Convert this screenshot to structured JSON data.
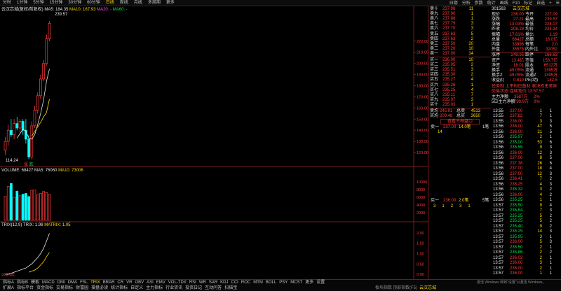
{
  "toolbar": {
    "items": [
      "分时",
      "1分钟",
      "5分钟",
      "15分钟",
      "30分钟",
      "60分钟",
      "日线",
      "周线",
      "月线",
      "多周期",
      "更多"
    ],
    "active": 6,
    "right_items": [
      "日期",
      "分析",
      "参数",
      "统计",
      "画线",
      "F10",
      "标记",
      "自选",
      "+",
      "☰"
    ]
  },
  "chart_header": {
    "stock": "云汉芯城(复权/前复权)",
    "ma5": "MA5: 184.35",
    "ma10": "MA10: 167.93",
    "ma20": "MA20: -",
    "ma60": "MA60: -",
    "high_label": "239.57",
    "low_label": "114.24",
    "marks": [
      "涨",
      "跌"
    ]
  },
  "price_axis": [
    "220.00",
    "210.00",
    "200.00",
    "190.00",
    "180.00",
    "170.00",
    "160.00",
    "150.00",
    "140.00",
    "130.00",
    "120.00"
  ],
  "volume_header": {
    "title": "VOLUME: 68427",
    "ma5": "MA5: 76060",
    "ma10": "MA10: 73006"
  },
  "volume_axis": [
    "10000",
    "8000",
    "6000",
    "4000",
    "2000"
  ],
  "trix_header": {
    "title": "TRIX(12,9)",
    "trix": "TRIX: 1.98",
    "matrix": "MATRIX: 1.05"
  },
  "trix_axis": [
    "2.00",
    "1.50",
    "1.00",
    "0.50",
    "0.00"
  ],
  "year_label": "2025年",
  "chart_data": {
    "type": "candlestick",
    "candles": [
      {
        "o": 122,
        "h": 134,
        "l": 118,
        "c": 130
      },
      {
        "o": 130,
        "h": 145,
        "l": 126,
        "c": 140
      },
      {
        "o": 140,
        "h": 150,
        "l": 134,
        "c": 136
      },
      {
        "o": 136,
        "h": 150,
        "l": 132,
        "c": 146
      },
      {
        "o": 146,
        "h": 152,
        "l": 140,
        "c": 142
      },
      {
        "o": 142,
        "h": 150,
        "l": 138,
        "c": 148
      },
      {
        "o": 148,
        "h": 150,
        "l": 136,
        "c": 140
      },
      {
        "o": 140,
        "h": 150,
        "l": 128,
        "c": 132
      },
      {
        "o": 132,
        "h": 136,
        "l": 114,
        "c": 116
      },
      {
        "o": 116,
        "h": 148,
        "l": 114,
        "c": 144
      },
      {
        "o": 144,
        "h": 162,
        "l": 142,
        "c": 158
      },
      {
        "o": 158,
        "h": 174,
        "l": 155,
        "c": 171
      },
      {
        "o": 171,
        "h": 190,
        "l": 168,
        "c": 186
      },
      {
        "o": 186,
        "h": 203,
        "l": 184,
        "c": 200
      },
      {
        "o": 200,
        "h": 226,
        "l": 198,
        "c": 222
      },
      {
        "o": 222,
        "h": 238,
        "l": 220,
        "c": 236
      }
    ],
    "ma5": [
      null,
      null,
      null,
      null,
      133,
      137,
      141,
      139,
      133,
      132,
      136,
      145,
      155,
      167,
      184,
      195
    ],
    "ma10": [
      null,
      null,
      null,
      null,
      null,
      null,
      null,
      null,
      null,
      135,
      139,
      143,
      147,
      152,
      156,
      168
    ],
    "volumes": [
      6200,
      8800,
      9600,
      6000,
      7600,
      6400,
      6800,
      7000,
      6200,
      7800,
      7900,
      6600,
      7000,
      7500,
      7200,
      6800
    ],
    "trix": [
      0.0,
      0.0,
      0.05,
      0.1,
      0.15,
      0.2,
      0.25,
      0.3,
      0.4,
      0.5,
      0.65,
      0.8,
      1.0,
      1.25,
      1.6,
      1.98
    ],
    "matrix": [
      null,
      null,
      null,
      null,
      null,
      null,
      null,
      null,
      0.1,
      0.15,
      0.2,
      0.3,
      0.45,
      0.6,
      0.85,
      1.05
    ],
    "price_range": [
      110,
      245
    ],
    "volume_range": [
      0,
      12000
    ],
    "trix_range": [
      -0.1,
      2.2
    ]
  },
  "sell_orders": [
    {
      "label": "卖十",
      "price": "237.98",
      "vol": "11"
    },
    {
      "label": "卖九",
      "price": "237.90",
      "vol": "1"
    },
    {
      "label": "卖八",
      "price": "237.88",
      "vol": "1"
    },
    {
      "label": "卖七",
      "price": "237.79",
      "vol": "3"
    },
    {
      "label": "卖六",
      "price": "237.70",
      "vol": "3"
    },
    {
      "label": "卖五",
      "price": "237.63",
      "vol": "5"
    },
    {
      "label": "卖四",
      "price": "237.63",
      "vol": "2"
    },
    {
      "label": "卖三",
      "price": "237.50",
      "vol": "20"
    },
    {
      "label": "卖二",
      "price": "237.20",
      "vol": "10"
    },
    {
      "label": "卖一",
      "price": "237.00",
      "vol": "14"
    }
  ],
  "buy_orders": [
    {
      "label": "买一",
      "price": "236.00",
      "vol": "10"
    },
    {
      "label": "买二",
      "price": "235.95",
      "vol": "2"
    },
    {
      "label": "买三",
      "price": "235.51",
      "vol": "3"
    },
    {
      "label": "买四",
      "price": "235.30",
      "vol": "2"
    },
    {
      "label": "买五",
      "price": "235.27",
      "vol": "4"
    },
    {
      "label": "买六",
      "price": "235.26",
      "vol": "1"
    },
    {
      "label": "买七",
      "price": "235.25",
      "vol": "4"
    },
    {
      "label": "买八",
      "price": "235.11",
      "vol": "7"
    },
    {
      "label": "买九",
      "price": "235.07",
      "vol": "3"
    },
    {
      "label": "买十",
      "price": "235.03",
      "vol": "1"
    }
  ],
  "order_summary": {
    "sell_avg_label": "卖均",
    "sell_avg": "245.91",
    "sell_total_label": "总卖",
    "sell_total": "4513",
    "buy_avg_label": "买均",
    "buy_avg": "209.48",
    "buy_total_label": "总买",
    "buy_total": "3650"
  },
  "queue_button": "查看千档盘口",
  "queue_sell": {
    "label": "卖一",
    "price": "237.00",
    "vol": "14.0笔",
    "count": "1笔"
  },
  "queue_sell_detail": "14",
  "queue_buy": {
    "label": "买一",
    "price": "236.00",
    "vol": "2.0笔",
    "count": "5笔"
  },
  "queue_buy_detail": [
    "3",
    "1",
    "2",
    "3",
    "1"
  ],
  "stock_info": {
    "code": "301563",
    "name": "云汉芯城",
    "rows": [
      {
        "k1": "现价",
        "v1": "236.00",
        "k2": "今开",
        "v2": "227.09"
      },
      {
        "k1": "涨跌",
        "v1": "27.21",
        "k2": "最高",
        "v2": "239.57"
      },
      {
        "k1": "涨幅",
        "v1": "13.03%",
        "k2": "最低",
        "v2": "224.07"
      },
      {
        "k1": "昨收",
        "v1": "208.29",
        "k2": "均价",
        "v2": "234.34"
      },
      {
        "k1": "振幅",
        "v1": "17.61%",
        "k2": "量比",
        "v2": "1.19"
      },
      {
        "k1": "总量",
        "v1": "68427",
        "k2": "总额",
        "v2": "16.0亿"
      },
      {
        "k1": "内盘",
        "v1": "33996",
        "k2": "每笔",
        "v2": "2.0"
      },
      {
        "k1": "外盘",
        "v1": "35575",
        "k2": "内外比",
        "v2": "32052"
      }
    ],
    "rows2": [
      {
        "k1": "涨停",
        "v1": "249.95",
        "k2": "跌停",
        "v2": "166.63"
      },
      {
        "k1": "资产",
        "v1": "13.4亿",
        "k2": "市值",
        "v2": "153.7亿"
      },
      {
        "k1": "净资",
        "v1": "18.01",
        "k2": "股本",
        "v2": "6512万"
      },
      {
        "k1": "换手",
        "v1": "49.05%",
        "k2": "流通",
        "v2": "1395万"
      },
      {
        "k1": "换手Z",
        "v1": "49.05%",
        "k2": "流通Z",
        "v2": "1395万"
      },
      {
        "k1": "收益(t)",
        "v1": "0.810",
        "k2": "PE(动)",
        "v2": "142.5"
      }
    ],
    "notes": [
      "任务制 上市时已盈利 表决权无差异",
      "交易状态:连续竞价 13:57:57"
    ],
    "net_label": "主力净额",
    "net_value": "3587万",
    "net_pct": "2%",
    "net5_label": "5日主力净额",
    "net5_value": "799.9万",
    "net5_pct": "0%"
  },
  "ticks": [
    {
      "t": "13:55",
      "p": "237.00",
      "v": "1",
      "n": "1"
    },
    {
      "t": "13:55",
      "p": "237.82",
      "v": "7",
      "n": "1"
    },
    {
      "t": "13:55",
      "p": "236.00",
      "v": "3",
      "n": "3"
    },
    {
      "t": "13:56",
      "p": "236.00",
      "v": "47",
      "n": "5"
    },
    {
      "t": "13:56",
      "p": "236.00",
      "v": "21",
      "n": "5"
    },
    {
      "t": "13:56",
      "p": "235.97",
      "v": "2",
      "n": "1"
    },
    {
      "t": "13:56",
      "p": "235.00",
      "v": "53",
      "n": "6"
    },
    {
      "t": "13:56",
      "p": "235.55",
      "v": "9",
      "n": "3"
    },
    {
      "t": "13:56",
      "p": "236.00",
      "v": "12",
      "n": "3"
    },
    {
      "t": "13:56",
      "p": "237.00",
      "v": "8",
      "n": "5"
    },
    {
      "t": "13:56",
      "p": "237.38",
      "v": "26",
      "n": "6"
    },
    {
      "t": "13:56",
      "p": "237.00",
      "v": "18",
      "n": "4"
    },
    {
      "t": "13:56",
      "p": "237.00",
      "v": "12",
      "n": "3"
    },
    {
      "t": "13:56",
      "p": "236.41",
      "v": "7",
      "n": "2"
    },
    {
      "t": "13:56",
      "p": "236.25",
      "v": "4",
      "n": "3"
    },
    {
      "t": "13:56",
      "p": "235.32",
      "v": "3",
      "n": "2"
    },
    {
      "t": "13:56",
      "p": "236.00",
      "v": "4",
      "n": "2"
    },
    {
      "t": "13:56",
      "p": "235.25",
      "v": "1",
      "n": "1"
    },
    {
      "t": "13:57",
      "p": "235.50",
      "v": "9",
      "n": "4"
    },
    {
      "t": "13:57",
      "p": "235.64",
      "v": "7",
      "n": "3"
    },
    {
      "t": "13:57",
      "p": "235.25",
      "v": "5",
      "n": "2"
    },
    {
      "t": "13:57",
      "p": "235.25",
      "v": "5",
      "n": "2"
    },
    {
      "t": "13:57",
      "p": "235.40",
      "v": "9",
      "n": "2"
    },
    {
      "t": "13:57",
      "p": "235.25",
      "v": "14",
      "n": "3"
    },
    {
      "t": "13:57",
      "p": "235.95",
      "v": "3",
      "n": "1"
    },
    {
      "t": "13:57",
      "p": "236.00",
      "v": "5",
      "n": "3"
    },
    {
      "t": "13:57",
      "p": "235.50",
      "v": "2",
      "n": "1"
    },
    {
      "t": "13:57",
      "p": "235.86",
      "v": "2",
      "n": "2"
    },
    {
      "t": "13:57",
      "p": "236.02",
      "v": "2",
      "n": "1"
    },
    {
      "t": "13:57",
      "p": "236.00",
      "v": "3",
      "n": "1"
    },
    {
      "t": "13:57",
      "p": "236.00",
      "v": "2",
      "n": "1"
    },
    {
      "t": "13:57",
      "p": "236.00",
      "v": "1",
      "n": "1"
    }
  ],
  "bottom_tabs": [
    "指标A",
    "指标B",
    "模板",
    "MACD",
    "DMI",
    "DMA",
    "FSL",
    "TRIX",
    "BRAR",
    "CR",
    "VR",
    "OBV",
    "ASI",
    "EMV",
    "VOL-TDX",
    "RSI",
    "WR",
    "SAR",
    "KDJ",
    "CCI",
    "ROC",
    "MTM",
    "BOLL",
    "PSY",
    "MCST",
    "更多",
    "设置"
  ],
  "bottom_tabs_active": 7,
  "bottom_tabs2": [
    "扩展A",
    "指标平台",
    "资金指标",
    "交易指标",
    "财富园",
    "操盘必读",
    "统计指标",
    "自定义",
    "主力指标",
    "行业资讯",
    "投资日记",
    "互动问答",
    "扫描宝"
  ],
  "status_bar": {
    "left": "板块指数",
    "center": "顶部指数(F5)",
    "notice": "云汉芯城",
    "right": "激活 Windows 转到\"设置\"以激活 Windows。",
    "date": "2025年"
  }
}
